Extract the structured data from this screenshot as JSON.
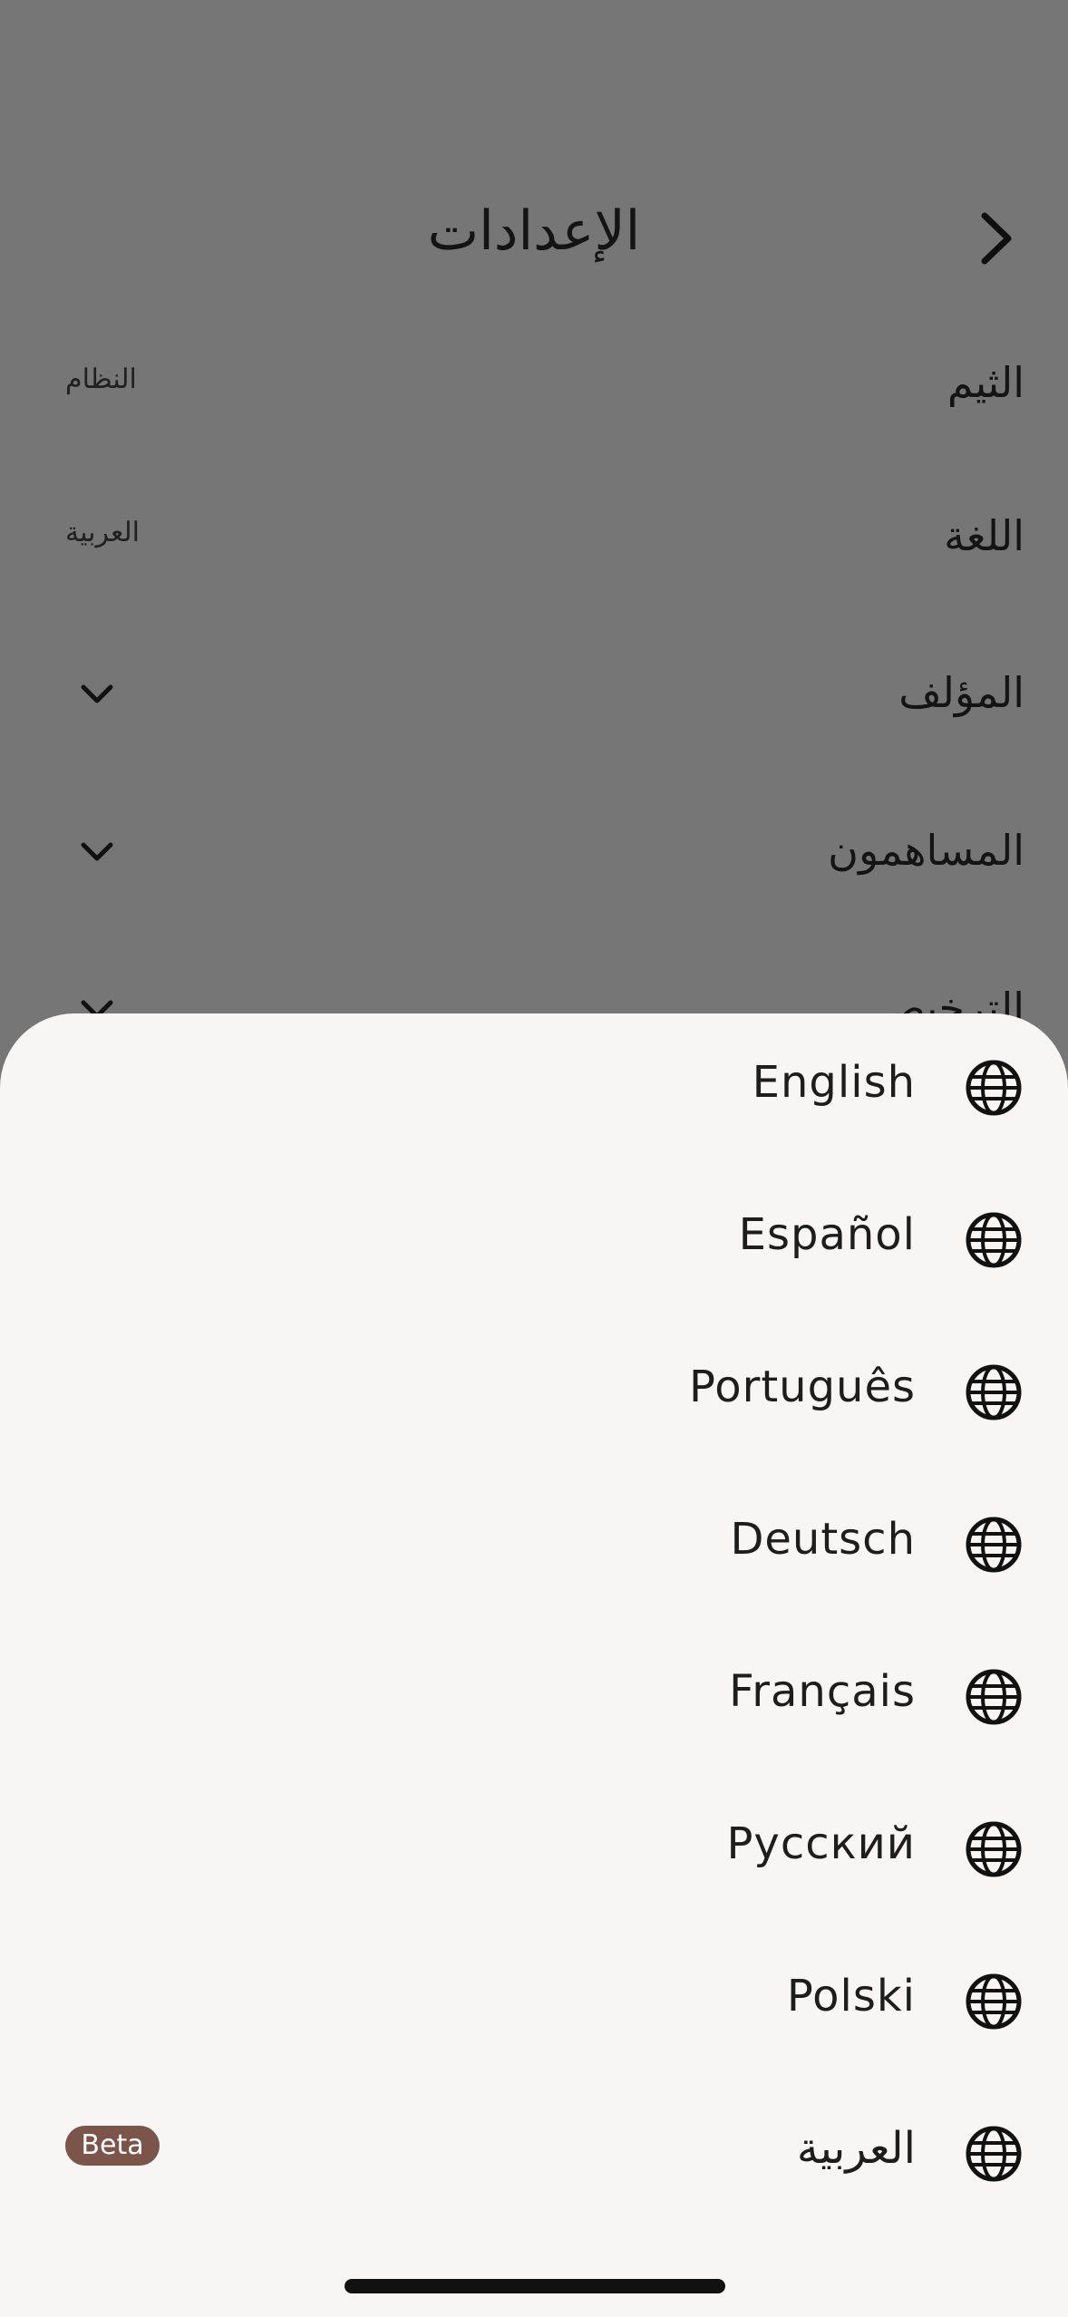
{
  "background": {
    "title": "الإعدادات",
    "settings": [
      {
        "label": "الثيم",
        "value": "النظام"
      },
      {
        "label": "اللغة",
        "value": "العربية"
      },
      {
        "label": "المؤلف",
        "value": ""
      },
      {
        "label": "المساهمون",
        "value": ""
      },
      {
        "label": "الترخيص",
        "value": ""
      }
    ]
  },
  "sheet": {
    "languages": [
      {
        "label": "English",
        "badge": ""
      },
      {
        "label": "Español",
        "badge": ""
      },
      {
        "label": "Português",
        "badge": ""
      },
      {
        "label": "Deutsch",
        "badge": ""
      },
      {
        "label": "Français",
        "badge": ""
      },
      {
        "label": "Русский",
        "badge": ""
      },
      {
        "label": "Polski",
        "badge": ""
      },
      {
        "label": "العربية",
        "badge": "Beta"
      }
    ]
  },
  "icons": {
    "back": "chevron-right-icon",
    "expand": "chevron-down-icon",
    "language": "globe-icon"
  },
  "colors": {
    "overlay": "#767676",
    "sheet": "#f7f6f4",
    "badge": "#7b5549",
    "text": "#1d1d1d"
  }
}
